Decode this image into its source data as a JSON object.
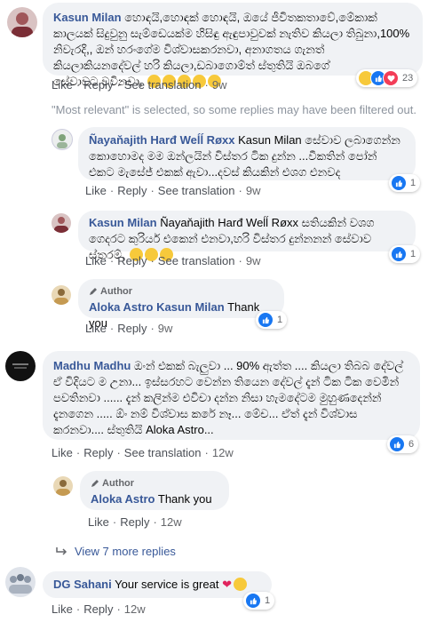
{
  "colors": {
    "link": "#385898",
    "meta": "#65676b",
    "bubble": "#f0f2f5",
    "like": "#1877f2"
  },
  "actions": {
    "like": "Like",
    "reply": "Reply",
    "see_translation": "See translation",
    "sep": "·"
  },
  "comment1": {
    "name": "Kasun Milan",
    "text": "හොඳයි,හොඳක් හොඳයි, ඔයේ ජීවිතකතාවේ,මේකාක් කාලයක් සිදුවුනු සැම්ඩෙයක්ම හිසිඳු ඇඳුපාවුවක් නැතිව කියලා තිබුනා,100% නිවැරදි,, ඔන් හරංගේම විශ්වාසකරනවා, අනාගතය ගැනත් කියලාකියනදේවල් හරි කියලා,ඩබාගොම්ත් ස්තුතියි ඔබගේ සේවාවට,වවිනවා,",
    "reactions": "23",
    "time": "9w"
  },
  "filter_note": "\"Most relevant\" is selected, so some replies may have been filtered out.",
  "reply1": {
    "name": "Ñayaňajith Harđ Weĺĺ Røxx",
    "text": "Kasun Milan සේවාව ලබාගෙන්න කොහොමද මම ඔන්ලයින් විස්තර ටික දුන්න ...වීකතින් පෝන් එකට මැසේජ් එකක් ඇවා...දවස් කියකින් එශග එනවද",
    "reactions": "1",
    "time": "9w"
  },
  "reply2": {
    "name": "Kasun Milan",
    "mention": "Ñayaňajith Harđ Weĺĺ Røxx",
    "text": "සතියකින් වශග ගෙදරට කුරියර් එකෙන් එනවා,හරි විස්තර දුන්නනන් සේවාව ස්තරම්,",
    "reactions": "1",
    "time": "9w"
  },
  "reply3": {
    "author_label": "Author",
    "name": "Aloka Astro",
    "mention": "Kasun Milan",
    "text": "Thank you",
    "reactions": "1",
    "time": "9w"
  },
  "comment2": {
    "name": "Madhu Madhu",
    "text": "ඔංන් එකක් බැලුවා ... 90% ඇත්ත .... කියලා තිබබ දේවල් ඒ විදියට ම උනා... ඉස්සරහට වෙන්න තියෙන දේවල් දැන් ටික ටික වෙමින් පවතිනවා ...... දැන් කලින්ම එවිචා දන්න නිසා හැමදේටම මුහුණදෙන්න් දැනගෙන ..... ඕං නම් විශ්වාස කරේ නෑ... මේච... ඒත් දැන් විශ්වාස කරනවා.... ස්තුතියි Aloka Astro...",
    "reactions": "6",
    "time": "12w"
  },
  "reply4": {
    "author_label": "Author",
    "name": "Aloka Astro",
    "text": "Thank you",
    "time": "12w"
  },
  "view_more": "View 7 more replies",
  "comment3": {
    "name": "DG Sahani",
    "text": "Your service is great",
    "reactions": "1",
    "time": "12w"
  }
}
